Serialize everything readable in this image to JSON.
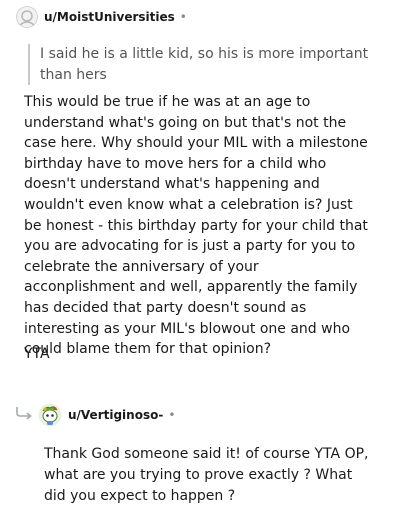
{
  "comments": [
    {
      "username": "u/MoistUniversities",
      "separator": "•",
      "avatar_icon": "default-avatar-icon",
      "quote": "I said he is a little kid, so his is more important than hers",
      "body": "This would be true if he was at an age to understand what's going on but that's not the case here. Why should your MIL with a milestone birthday have to move hers for a child who doesn't understand what's happening and wouldn't even know what a celebration is? Just be honest - this birthday party for your child that you are advocating for is just a party for you to celebrate the anniversary of your acconplishment and well, apparently the family has decided that party doesn't sound as interesting as your MIL's blowout one and who could blame them for that opinion?",
      "verdict": "YTA"
    },
    {
      "username": "u/Vertiginoso-",
      "separator": "•",
      "avatar_icon": "snoo-avatar-icon",
      "reply_icon": "reply-arrow-icon",
      "body": "Thank God someone said it! of course YTA OP, what are you trying to prove exactly ? What did you expect to happen ?"
    }
  ],
  "colors": {
    "text": "#1a1a1b",
    "quote_bar": "#c8c8c8",
    "meta": "#878a8c"
  }
}
